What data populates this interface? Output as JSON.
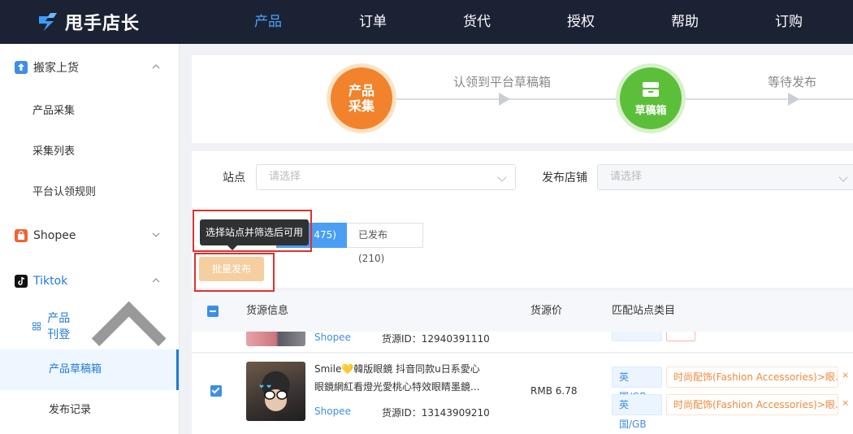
{
  "app": {
    "name": "甩手店长"
  },
  "nav": [
    {
      "label": "产品",
      "active": true
    },
    {
      "label": "订单"
    },
    {
      "label": "货代"
    },
    {
      "label": "授权"
    },
    {
      "label": "帮助"
    },
    {
      "label": "订购"
    }
  ],
  "sidebar": {
    "group1": {
      "label": "搬家上货",
      "icon": "upload-icon"
    },
    "items1": [
      "产品采集",
      "采集列表",
      "平台认领规则"
    ],
    "shopee": {
      "label": "Shopee",
      "icon": "shopee-bag-icon"
    },
    "tiktok": {
      "label": "Tiktok",
      "icon": "tiktok-icon"
    },
    "sub_group": {
      "label": "产品刊登",
      "icon": "grid-icon"
    },
    "sub_items": [
      "产品草稿箱",
      "发布记录"
    ]
  },
  "steps": {
    "step1": "产品\n采集",
    "step1_l1": "产品",
    "step1_l2": "采集",
    "arrow1_label": "认领到平台草稿箱",
    "step2": "草稿箱",
    "arrow2_label": "等待发布"
  },
  "filter": {
    "site_label": "站点",
    "site_placeholder": "请选择",
    "store_label": "发布店铺",
    "store_placeholder": "请选择"
  },
  "tabs": [
    {
      "label": "475)"
    },
    {
      "label": "已发布(210)"
    }
  ],
  "tooltip": "选择站点并筛选后可用",
  "batch_publish": "批量发布",
  "table": {
    "col_source": "货源信息",
    "col_price": "货源价",
    "col_category": "匹配站点类目"
  },
  "rows": [
    {
      "shop": "Shopee",
      "source_id_label": "货源ID：",
      "source_id": "12940391110"
    },
    {
      "title_line1": "Smile💛韓版眼鏡 抖音同款u日系愛心",
      "title_line2": "眼鏡網紅看燈光愛桃心特效眼睛墨鏡...",
      "shop": "Shopee",
      "source_id_label": "货源ID：",
      "source_id": "13143909210",
      "price": "RMB 6.78",
      "site1": "英国/GB",
      "cat1": "时尚配饰(Fashion Accessories)>眼...",
      "site2": "英国/GB",
      "cat2": "时尚配饰(Fashion Accessories)>眼...",
      "checked": true
    }
  ],
  "colors": {
    "accent": "#3d8ee8",
    "nav_bg": "#1b2233",
    "orange": "#f08a3a",
    "green": "#5bbf3a"
  }
}
